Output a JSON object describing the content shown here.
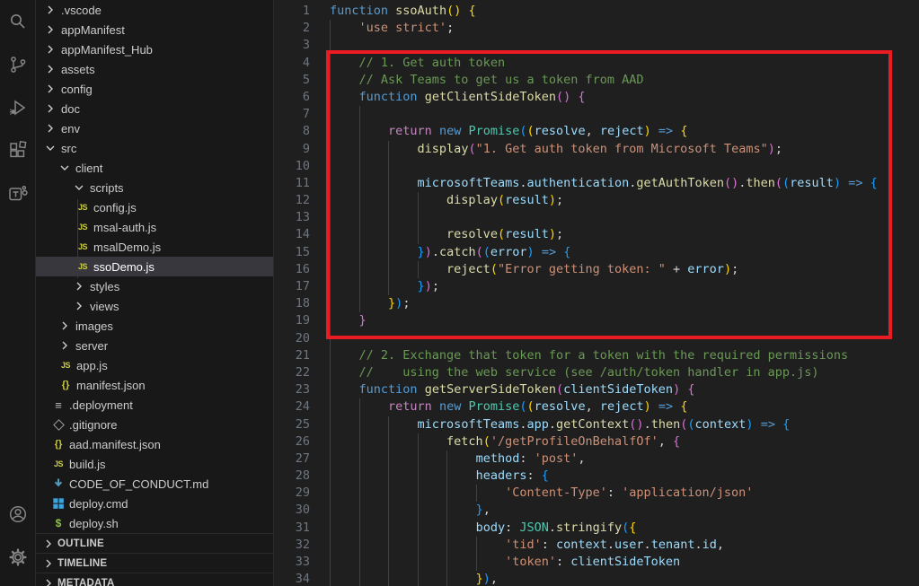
{
  "palette": {
    "comment": "#6A9955",
    "keyword": "#569CD6",
    "control": "#C586C0",
    "function": "#DCDCAA",
    "type": "#4EC9B0",
    "variable": "#9CDCFE",
    "string": "#CE9178",
    "plain": "#D4D4D4",
    "bracket1": "#FFD700",
    "bracket2": "#DA70D6",
    "bracket3": "#179FFF",
    "annotation": "#EA1B23",
    "selection_bg": "#37373D",
    "line_number": "#6E7681"
  },
  "activity_bar": {
    "top": [
      "search",
      "source-control",
      "run-and-debug",
      "extensions",
      "teams-toolkit"
    ],
    "bottom": [
      "account",
      "manage-settings"
    ]
  },
  "sidebar": {
    "items": [
      {
        "label": ".vscode",
        "kind": "folder",
        "indent": 8,
        "expanded": false
      },
      {
        "label": "appManifest",
        "kind": "folder",
        "indent": 8,
        "expanded": false
      },
      {
        "label": "appManifest_Hub",
        "kind": "folder",
        "indent": 8,
        "expanded": false
      },
      {
        "label": "assets",
        "kind": "folder",
        "indent": 8,
        "expanded": false
      },
      {
        "label": "config",
        "kind": "folder",
        "indent": 8,
        "expanded": false
      },
      {
        "label": "doc",
        "kind": "folder",
        "indent": 8,
        "expanded": false
      },
      {
        "label": "env",
        "kind": "folder",
        "indent": 8,
        "expanded": false
      },
      {
        "label": "src",
        "kind": "folder",
        "indent": 8,
        "expanded": true
      },
      {
        "label": "client",
        "kind": "folder",
        "indent": 24,
        "expanded": true
      },
      {
        "label": "scripts",
        "kind": "folder",
        "indent": 40,
        "expanded": true
      },
      {
        "label": "config.js",
        "kind": "file",
        "icon": "js",
        "indent": 44
      },
      {
        "label": "msal-auth.js",
        "kind": "file",
        "icon": "js",
        "indent": 44
      },
      {
        "label": "msalDemo.js",
        "kind": "file",
        "icon": "js",
        "indent": 44
      },
      {
        "label": "ssoDemo.js",
        "kind": "file",
        "icon": "js",
        "indent": 44,
        "selected": true
      },
      {
        "label": "styles",
        "kind": "folder",
        "indent": 40,
        "expanded": false
      },
      {
        "label": "views",
        "kind": "folder",
        "indent": 40,
        "expanded": false
      },
      {
        "label": "images",
        "kind": "folder",
        "indent": 24,
        "expanded": false
      },
      {
        "label": "server",
        "kind": "folder",
        "indent": 24,
        "expanded": false
      },
      {
        "label": "app.js",
        "kind": "file",
        "icon": "js",
        "indent": 25
      },
      {
        "label": "manifest.json",
        "kind": "file",
        "icon": "json",
        "indent": 25
      },
      {
        "label": ".deployment",
        "kind": "file",
        "icon": "list",
        "indent": 17
      },
      {
        "label": ".gitignore",
        "kind": "file",
        "icon": "git",
        "indent": 17
      },
      {
        "label": "aad.manifest.json",
        "kind": "file",
        "icon": "json",
        "indent": 17
      },
      {
        "label": "build.js",
        "kind": "file",
        "icon": "js",
        "indent": 17
      },
      {
        "label": "CODE_OF_CONDUCT.md",
        "kind": "file",
        "icon": "md",
        "indent": 17
      },
      {
        "label": "deploy.cmd",
        "kind": "file",
        "icon": "windows",
        "indent": 17
      },
      {
        "label": "deploy.sh",
        "kind": "file",
        "icon": "shell",
        "indent": 17
      }
    ],
    "panels": [
      {
        "label": "OUTLINE"
      },
      {
        "label": "TIMELINE"
      },
      {
        "label": "METADATA"
      }
    ]
  },
  "editor": {
    "annotation": {
      "shape": "rectangle",
      "color": "#EA1B23",
      "covers_lines": "4-20"
    },
    "lines": [
      {
        "n": 1,
        "g": 0,
        "t": [
          [
            "function",
            "k"
          ],
          [
            " ",
            "p"
          ],
          [
            "ssoAuth",
            "f"
          ],
          [
            "()",
            "b1"
          ],
          [
            " ",
            "p"
          ],
          [
            "{",
            "b1"
          ]
        ]
      },
      {
        "n": 2,
        "g": 1,
        "t": [
          [
            "    ",
            "p"
          ],
          [
            "'use strict'",
            "s"
          ],
          [
            ";",
            "p"
          ]
        ]
      },
      {
        "n": 3,
        "g": 1,
        "t": []
      },
      {
        "n": 4,
        "g": 1,
        "t": [
          [
            "    ",
            "p"
          ],
          [
            "// 1. Get auth token",
            "c"
          ]
        ]
      },
      {
        "n": 5,
        "g": 1,
        "t": [
          [
            "    ",
            "p"
          ],
          [
            "// Ask Teams to get us a token from AAD",
            "c"
          ]
        ]
      },
      {
        "n": 6,
        "g": 1,
        "t": [
          [
            "    ",
            "p"
          ],
          [
            "function",
            "k"
          ],
          [
            " ",
            "p"
          ],
          [
            "getClientSideToken",
            "f"
          ],
          [
            "()",
            "b2"
          ],
          [
            " ",
            "p"
          ],
          [
            "{",
            "b2"
          ]
        ]
      },
      {
        "n": 7,
        "g": 2,
        "t": []
      },
      {
        "n": 8,
        "g": 2,
        "t": [
          [
            "        ",
            "p"
          ],
          [
            "return",
            "ctl"
          ],
          [
            " ",
            "p"
          ],
          [
            "new",
            "k"
          ],
          [
            " ",
            "p"
          ],
          [
            "Promise",
            "t"
          ],
          [
            "(",
            "b3"
          ],
          [
            "(",
            "b1"
          ],
          [
            "resolve",
            "v"
          ],
          [
            ", ",
            "p"
          ],
          [
            "reject",
            "v"
          ],
          [
            ")",
            "b1"
          ],
          [
            " ",
            "p"
          ],
          [
            "=>",
            "k"
          ],
          [
            " ",
            "p"
          ],
          [
            "{",
            "b1"
          ]
        ]
      },
      {
        "n": 9,
        "g": 3,
        "t": [
          [
            "            ",
            "p"
          ],
          [
            "display",
            "f"
          ],
          [
            "(",
            "b2"
          ],
          [
            "\"1. Get auth token from Microsoft Teams\"",
            "s"
          ],
          [
            ")",
            "b2"
          ],
          [
            ";",
            "p"
          ]
        ]
      },
      {
        "n": 10,
        "g": 3,
        "t": []
      },
      {
        "n": 11,
        "g": 3,
        "t": [
          [
            "            ",
            "p"
          ],
          [
            "microsoftTeams",
            "v"
          ],
          [
            ".",
            "p"
          ],
          [
            "authentication",
            "v"
          ],
          [
            ".",
            "p"
          ],
          [
            "getAuthToken",
            "f"
          ],
          [
            "()",
            "b2"
          ],
          [
            ".",
            "p"
          ],
          [
            "then",
            "f"
          ],
          [
            "(",
            "b2"
          ],
          [
            "(",
            "b3"
          ],
          [
            "result",
            "v"
          ],
          [
            ")",
            "b3"
          ],
          [
            " ",
            "p"
          ],
          [
            "=>",
            "k"
          ],
          [
            " ",
            "p"
          ],
          [
            "{",
            "b3"
          ]
        ]
      },
      {
        "n": 12,
        "g": 4,
        "t": [
          [
            "                ",
            "p"
          ],
          [
            "display",
            "f"
          ],
          [
            "(",
            "b1"
          ],
          [
            "result",
            "v"
          ],
          [
            ")",
            "b1"
          ],
          [
            ";",
            "p"
          ]
        ]
      },
      {
        "n": 13,
        "g": 4,
        "t": []
      },
      {
        "n": 14,
        "g": 4,
        "t": [
          [
            "                ",
            "p"
          ],
          [
            "resolve",
            "f"
          ],
          [
            "(",
            "b1"
          ],
          [
            "result",
            "v"
          ],
          [
            ")",
            "b1"
          ],
          [
            ";",
            "p"
          ]
        ]
      },
      {
        "n": 15,
        "g": 3,
        "t": [
          [
            "            ",
            "p"
          ],
          [
            "}",
            "b3"
          ],
          [
            ")",
            "b2"
          ],
          [
            ".",
            "p"
          ],
          [
            "catch",
            "f"
          ],
          [
            "(",
            "b2"
          ],
          [
            "(",
            "b3"
          ],
          [
            "error",
            "v"
          ],
          [
            ")",
            "b3"
          ],
          [
            " ",
            "p"
          ],
          [
            "=>",
            "k"
          ],
          [
            " ",
            "p"
          ],
          [
            "{",
            "b3"
          ]
        ]
      },
      {
        "n": 16,
        "g": 4,
        "t": [
          [
            "                ",
            "p"
          ],
          [
            "reject",
            "f"
          ],
          [
            "(",
            "b1"
          ],
          [
            "\"Error getting token: \"",
            "s"
          ],
          [
            " + ",
            "p"
          ],
          [
            "error",
            "v"
          ],
          [
            ")",
            "b1"
          ],
          [
            ";",
            "p"
          ]
        ]
      },
      {
        "n": 17,
        "g": 3,
        "t": [
          [
            "            ",
            "p"
          ],
          [
            "}",
            "b3"
          ],
          [
            ")",
            "b2"
          ],
          [
            ";",
            "p"
          ]
        ]
      },
      {
        "n": 18,
        "g": 2,
        "t": [
          [
            "        ",
            "p"
          ],
          [
            "}",
            "b1"
          ],
          [
            ")",
            "b3"
          ],
          [
            ";",
            "p"
          ]
        ]
      },
      {
        "n": 19,
        "g": 1,
        "t": [
          [
            "    ",
            "p"
          ],
          [
            "}",
            "b2"
          ]
        ]
      },
      {
        "n": 20,
        "g": 1,
        "t": []
      },
      {
        "n": 21,
        "g": 1,
        "t": [
          [
            "    ",
            "p"
          ],
          [
            "// 2. Exchange that token for a token with the required permissions",
            "c"
          ]
        ]
      },
      {
        "n": 22,
        "g": 1,
        "t": [
          [
            "    ",
            "p"
          ],
          [
            "//    using the web service (see /auth/token handler in app.js)",
            "c"
          ]
        ]
      },
      {
        "n": 23,
        "g": 1,
        "t": [
          [
            "    ",
            "p"
          ],
          [
            "function",
            "k"
          ],
          [
            " ",
            "p"
          ],
          [
            "getServerSideToken",
            "f"
          ],
          [
            "(",
            "b2"
          ],
          [
            "clientSideToken",
            "v"
          ],
          [
            ")",
            "b2"
          ],
          [
            " ",
            "p"
          ],
          [
            "{",
            "b2"
          ]
        ]
      },
      {
        "n": 24,
        "g": 2,
        "t": [
          [
            "        ",
            "p"
          ],
          [
            "return",
            "ctl"
          ],
          [
            " ",
            "p"
          ],
          [
            "new",
            "k"
          ],
          [
            " ",
            "p"
          ],
          [
            "Promise",
            "t"
          ],
          [
            "(",
            "b3"
          ],
          [
            "(",
            "b1"
          ],
          [
            "resolve",
            "v"
          ],
          [
            ", ",
            "p"
          ],
          [
            "reject",
            "v"
          ],
          [
            ")",
            "b1"
          ],
          [
            " ",
            "p"
          ],
          [
            "=>",
            "k"
          ],
          [
            " ",
            "p"
          ],
          [
            "{",
            "b1"
          ]
        ]
      },
      {
        "n": 25,
        "g": 3,
        "t": [
          [
            "            ",
            "p"
          ],
          [
            "microsoftTeams",
            "v"
          ],
          [
            ".",
            "p"
          ],
          [
            "app",
            "v"
          ],
          [
            ".",
            "p"
          ],
          [
            "getContext",
            "f"
          ],
          [
            "()",
            "b2"
          ],
          [
            ".",
            "p"
          ],
          [
            "then",
            "f"
          ],
          [
            "(",
            "b2"
          ],
          [
            "(",
            "b3"
          ],
          [
            "context",
            "v"
          ],
          [
            ")",
            "b3"
          ],
          [
            " ",
            "p"
          ],
          [
            "=>",
            "k"
          ],
          [
            " ",
            "p"
          ],
          [
            "{",
            "b3"
          ]
        ]
      },
      {
        "n": 26,
        "g": 4,
        "t": [
          [
            "                ",
            "p"
          ],
          [
            "fetch",
            "f"
          ],
          [
            "(",
            "b1"
          ],
          [
            "'/getProfileOnBehalfOf'",
            "s"
          ],
          [
            ", ",
            "p"
          ],
          [
            "{",
            "b2"
          ]
        ]
      },
      {
        "n": 27,
        "g": 5,
        "t": [
          [
            "                    ",
            "p"
          ],
          [
            "method",
            "v"
          ],
          [
            ": ",
            "p"
          ],
          [
            "'post'",
            "s"
          ],
          [
            ",",
            "p"
          ]
        ]
      },
      {
        "n": 28,
        "g": 5,
        "t": [
          [
            "                    ",
            "p"
          ],
          [
            "headers",
            "v"
          ],
          [
            ": ",
            "p"
          ],
          [
            "{",
            "b3"
          ]
        ]
      },
      {
        "n": 29,
        "g": 6,
        "t": [
          [
            "                        ",
            "p"
          ],
          [
            "'Content-Type'",
            "s"
          ],
          [
            ": ",
            "p"
          ],
          [
            "'application/json'",
            "s"
          ]
        ]
      },
      {
        "n": 30,
        "g": 5,
        "t": [
          [
            "                    ",
            "p"
          ],
          [
            "}",
            "b3"
          ],
          [
            ",",
            "p"
          ]
        ]
      },
      {
        "n": 31,
        "g": 5,
        "t": [
          [
            "                    ",
            "p"
          ],
          [
            "body",
            "v"
          ],
          [
            ": ",
            "p"
          ],
          [
            "JSON",
            "t"
          ],
          [
            ".",
            "p"
          ],
          [
            "stringify",
            "f"
          ],
          [
            "(",
            "b3"
          ],
          [
            "{",
            "b1"
          ]
        ]
      },
      {
        "n": 32,
        "g": 6,
        "t": [
          [
            "                        ",
            "p"
          ],
          [
            "'tid'",
            "s"
          ],
          [
            ": ",
            "p"
          ],
          [
            "context",
            "v"
          ],
          [
            ".",
            "p"
          ],
          [
            "user",
            "v"
          ],
          [
            ".",
            "p"
          ],
          [
            "tenant",
            "v"
          ],
          [
            ".",
            "p"
          ],
          [
            "id",
            "v"
          ],
          [
            ",",
            "p"
          ]
        ]
      },
      {
        "n": 33,
        "g": 6,
        "t": [
          [
            "                        ",
            "p"
          ],
          [
            "'token'",
            "s"
          ],
          [
            ": ",
            "p"
          ],
          [
            "clientSideToken",
            "v"
          ]
        ]
      },
      {
        "n": 34,
        "g": 5,
        "t": [
          [
            "                    ",
            "p"
          ],
          [
            "}",
            "b1"
          ],
          [
            ")",
            "b3"
          ],
          [
            ",",
            "p"
          ]
        ]
      }
    ]
  }
}
